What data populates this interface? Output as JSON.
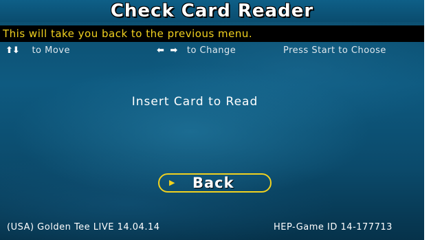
{
  "screen": {
    "title": "Check Card Reader",
    "message": "This will take you back to the previous menu."
  },
  "controls": {
    "move_icon": "up-down-arrows-icon",
    "move_arrows": "⬆⬇",
    "move_label": "to Move",
    "change_icon": "left-right-arrows-icon",
    "change_left": "⬅",
    "change_right": "➡",
    "change_label": "to Change",
    "choose_label": "Press Start to Choose"
  },
  "main": {
    "prompt": "Insert Card to Read",
    "back_icon": "play-chevron-icon",
    "back_chevron": "▶",
    "back_label": "Back"
  },
  "footer": {
    "version": "(USA) Golden Tee LIVE 14.04.14",
    "game_id": "HEP-Game ID 14-177713"
  },
  "colors": {
    "accent": "#f2d21f",
    "background": "#0c4d6d",
    "message_bar": "#000000",
    "text": "#ffffff"
  }
}
